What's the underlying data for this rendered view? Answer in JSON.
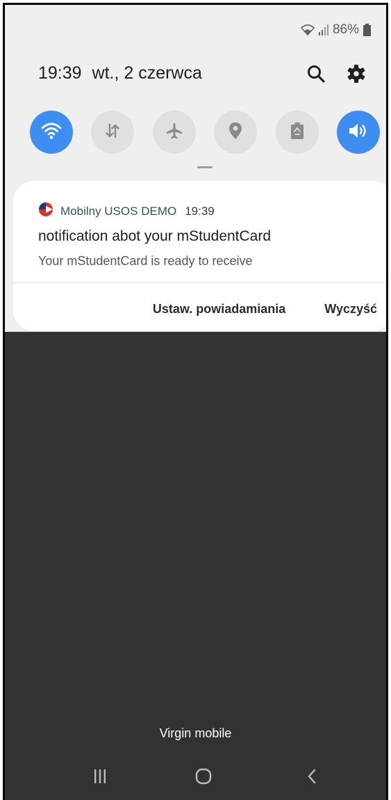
{
  "status_bar": {
    "battery": "86%"
  },
  "header": {
    "time": "19:39",
    "date": "wt., 2 czerwca"
  },
  "icons": {
    "search": "search-icon",
    "settings": "gear-icon"
  },
  "quick_settings": [
    {
      "name": "wifi",
      "icon": "wifi-icon",
      "active": true
    },
    {
      "name": "mobile-data",
      "icon": "data-arrows-icon",
      "active": false
    },
    {
      "name": "airplane-mode",
      "icon": "airplane-icon",
      "active": false
    },
    {
      "name": "location",
      "icon": "location-pin-icon",
      "active": false
    },
    {
      "name": "power-saving",
      "icon": "battery-recycle-icon",
      "active": false
    },
    {
      "name": "sound",
      "icon": "volume-icon",
      "active": true
    }
  ],
  "notification": {
    "app_name": "Mobilny USOS DEMO",
    "time": "19:39",
    "title": "notification abot your mStudentCard",
    "body": "Your mStudentCard is ready to receive",
    "actions": {
      "settings": "Ustaw. powiadamiania",
      "clear": "Wyczyść"
    }
  },
  "carrier": "Virgin mobile",
  "colors": {
    "accent": "#3e8ef1",
    "shade_bg": "#efefef",
    "dark_bg": "#323232",
    "toggle_off": "#e0e0e0"
  }
}
